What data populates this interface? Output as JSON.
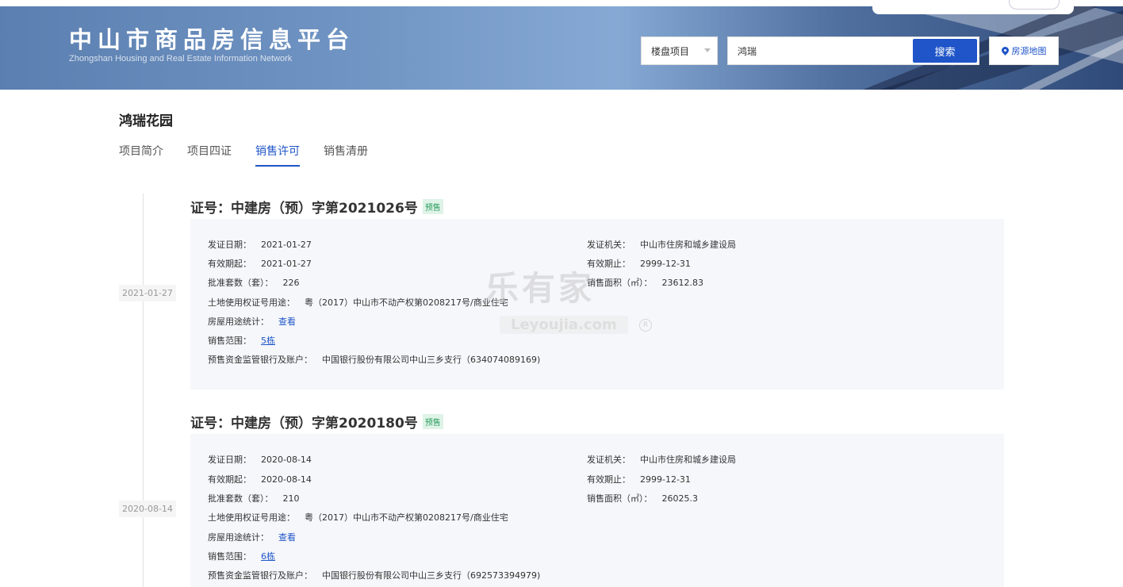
{
  "header": {
    "title": "中山市商品房信息平台",
    "subtitle": "Zhongshan Housing and Real Estate Information Network",
    "search_type": "楼盘项目",
    "search_value": "鸿瑞",
    "search_button": "搜索",
    "map_button": "房源地图"
  },
  "project": {
    "name": "鸿瑞花园",
    "tabs": [
      "项目简介",
      "项目四证",
      "销售许可",
      "销售清册"
    ],
    "active_tab": "销售许可"
  },
  "certificates": [
    {
      "date": "2021-01-27",
      "title": "证号：中建房（预）字第2021026号",
      "badge": "预售",
      "issue_date_label": "发证日期：",
      "issue_date": "2021-01-27",
      "authority_label": "发证机关：",
      "authority": "中山市住房和城乡建设局",
      "valid_from_label": "有效期起：",
      "valid_from": "2021-01-27",
      "valid_to_label": "有效期止：",
      "valid_to": "2999-12-31",
      "units_label": "批准套数（套）：",
      "units": "226",
      "area_label": "销售面积（㎡）：",
      "area": "23612.83",
      "land_label": "土地使用权证号用途：",
      "land": "粤（2017）中山市不动产权第0208217号/商业住宅",
      "usage_label": "房屋用途统计：",
      "usage_link": "查看",
      "range_label": "销售范围：",
      "range_link": "5栋",
      "bank_label": "预售资金监管银行及账户：",
      "bank": "中国银行股份有限公司中山三乡支行（634074089169)"
    },
    {
      "date": "2020-08-14",
      "title": "证号：中建房（预）字第2020180号",
      "badge": "预售",
      "issue_date_label": "发证日期：",
      "issue_date": "2020-08-14",
      "authority_label": "发证机关：",
      "authority": "中山市住房和城乡建设局",
      "valid_from_label": "有效期起：",
      "valid_from": "2020-08-14",
      "valid_to_label": "有效期止：",
      "valid_to": "2999-12-31",
      "units_label": "批准套数（套）：",
      "units": "210",
      "area_label": "销售面积（㎡）：",
      "area": "26025.3",
      "land_label": "土地使用权证号用途：",
      "land": "粤（2017）中山市不动产权第0208217号/商业住宅",
      "usage_label": "房屋用途统计：",
      "usage_link": "查看",
      "range_label": "销售范围：",
      "range_link": "6栋",
      "bank_label": "预售资金监管银行及账户：",
      "bank": "中国银行股份有限公司中山三乡支行（692573394979)"
    }
  ],
  "watermark": {
    "text": "乐有家",
    "domain": "Leyoujia.com"
  }
}
